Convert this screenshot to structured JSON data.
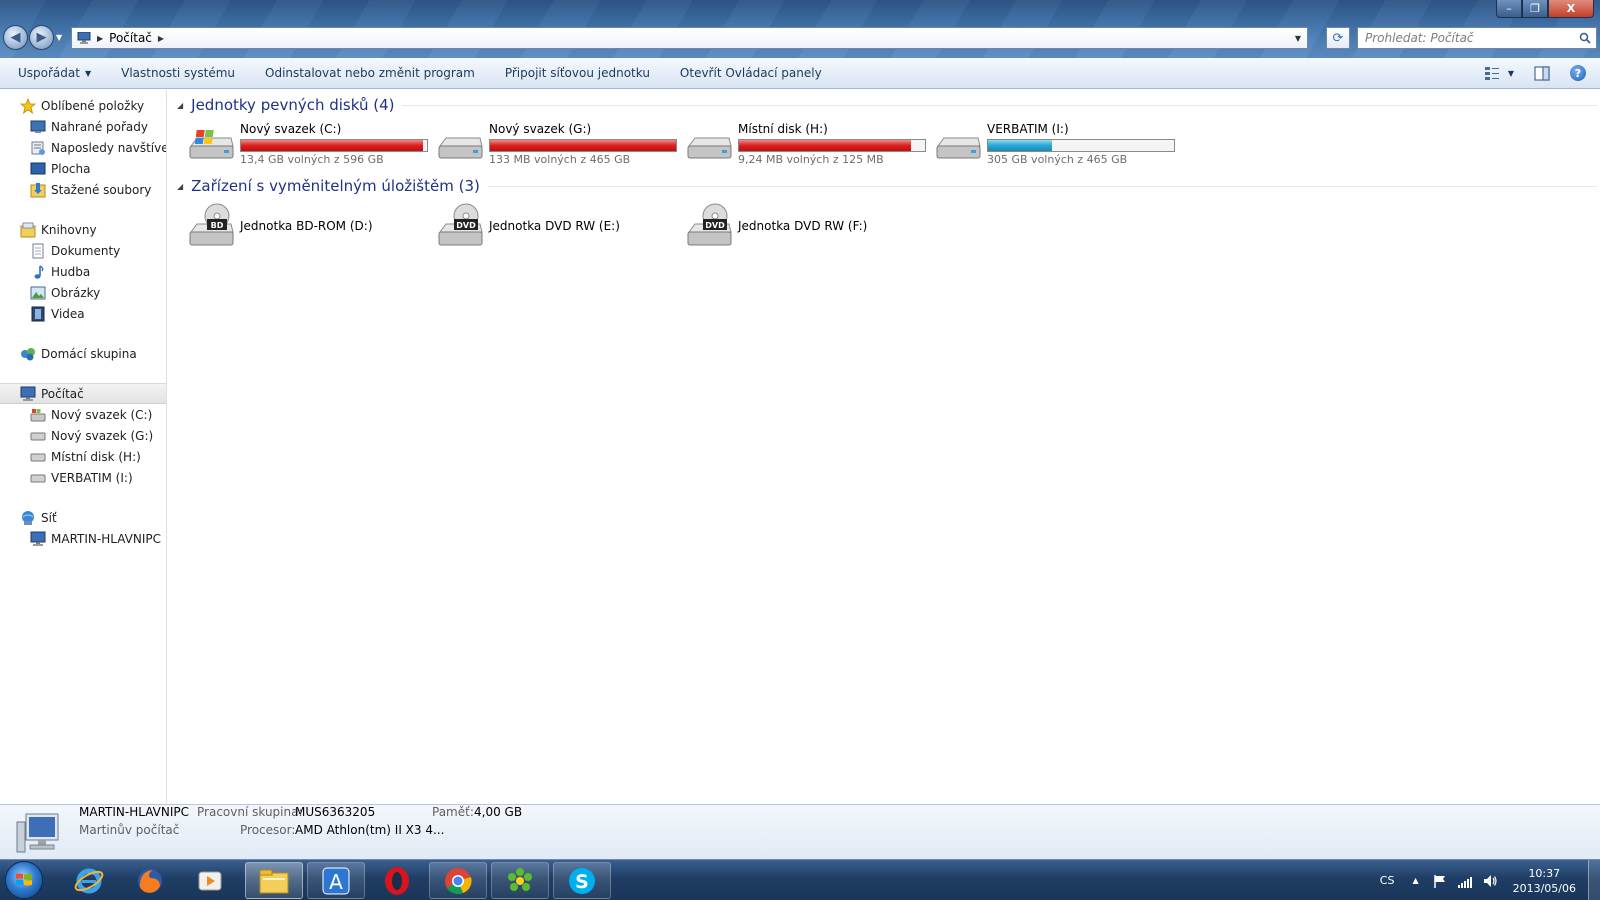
{
  "window": {
    "minimize_label": "–",
    "restore_label": "❐",
    "close_label": "X"
  },
  "address": {
    "crumbs": [
      "Počítač"
    ],
    "search_placeholder": "Prohledat: Počítač"
  },
  "toolbar": {
    "organize": "Uspořádat",
    "system_properties": "Vlastnosti systému",
    "uninstall": "Odinstalovat nebo změnit program",
    "map_drive": "Připojit síťovou jednotku",
    "control_panel": "Otevřít Ovládací panely",
    "help": "?"
  },
  "sidebar": {
    "favorites": {
      "label": "Oblíbené položky",
      "items": [
        "Nahrané pořady",
        "Naposledy navštívené",
        "Plocha",
        "Stažené soubory"
      ]
    },
    "libraries": {
      "label": "Knihovny",
      "items": [
        "Dokumenty",
        "Hudba",
        "Obrázky",
        "Videa"
      ]
    },
    "homegroup": {
      "label": "Domácí skupina"
    },
    "computer": {
      "label": "Počítač",
      "items": [
        "Nový svazek (C:)",
        "Nový svazek (G:)",
        "Místní disk (H:)",
        "VERBATIM (I:)"
      ]
    },
    "network": {
      "label": "Síť",
      "items": [
        "MARTIN-HLAVNIPC"
      ]
    }
  },
  "hard_drives": {
    "title": "Jednotky pevných disků (4)",
    "items": [
      {
        "name": "Nový svazek (C:)",
        "free": "13,4 GB volných z 596 GB",
        "used_fraction": 0.978,
        "bar_color": "red",
        "windows_logo": true
      },
      {
        "name": "Nový svazek (G:)",
        "free": "133 MB volných z 465 GB",
        "used_fraction": 0.9997,
        "bar_color": "red",
        "windows_logo": false
      },
      {
        "name": "Místní disk (H:)",
        "free": "9,24 MB volných z 125 MB",
        "used_fraction": 0.926,
        "bar_color": "red",
        "windows_logo": false
      },
      {
        "name": "VERBATIM (I:)",
        "free": "305 GB volných z 465 GB",
        "used_fraction": 0.344,
        "bar_color": "blue",
        "windows_logo": false
      }
    ]
  },
  "removable": {
    "title": "Zařízení s vyměnitelným úložištěm (3)",
    "items": [
      {
        "name": "Jednotka BD-ROM (D:)",
        "badge": "BD"
      },
      {
        "name": "Jednotka DVD RW (E:)",
        "badge": "DVD"
      },
      {
        "name": "Jednotka DVD RW (F:)",
        "badge": "DVD"
      }
    ]
  },
  "details": {
    "computer_name": "MARTIN-HLAVNIPC",
    "description": "Martinův počítač",
    "workgroup_label": "Pracovní skupina:",
    "workgroup_value": "MUS6363205",
    "memory_label": "Paměť:",
    "memory_value": "4,00 GB",
    "cpu_label": "Procesor:",
    "cpu_value": "AMD Athlon(tm) II X3 4..."
  },
  "taskbar": {
    "apps": [
      "internet-explorer",
      "firefox",
      "media-player",
      "explorer",
      "app-a",
      "opera",
      "chrome",
      "icq",
      "skype"
    ],
    "app_a_letter": "A",
    "skype_letter": "S",
    "language": "CS",
    "time": "10:37",
    "date": "2013/05/06"
  },
  "colors": {
    "titlebar": "#3e6fa6",
    "progress_red": "#dc1f1f",
    "progress_blue": "#26a7d6",
    "link_blue": "#1e3287",
    "taskbar": "#1f3e66"
  }
}
